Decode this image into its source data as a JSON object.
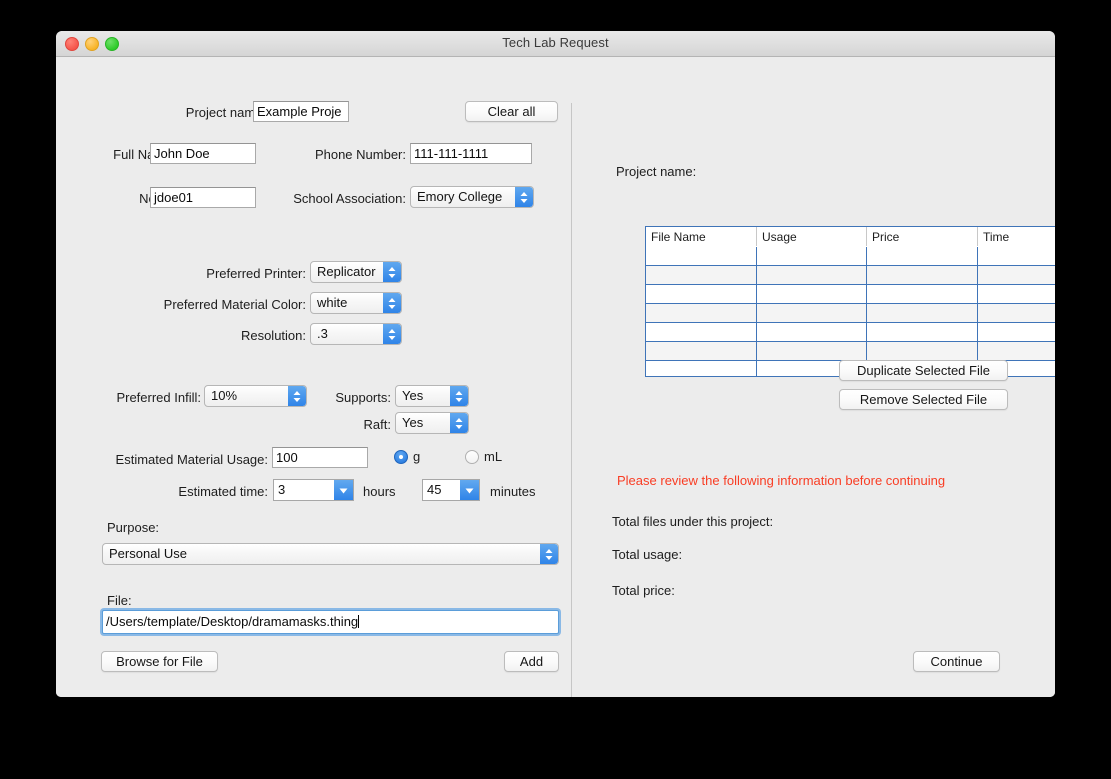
{
  "window": {
    "title": "Tech Lab Request",
    "traffic_lights": [
      "close",
      "minimize",
      "zoom"
    ]
  },
  "left_panel": {
    "project_name_label": "Project name:",
    "project_name_value": "Example Proje",
    "clear_all_label": "Clear all",
    "full_name_label": "Full Name:",
    "full_name_value": "John Doe",
    "phone_label": "Phone Number:",
    "phone_value": "111-111-1111",
    "netid_label": "NetID:",
    "netid_value": "jdoe01",
    "school_label": "School Association:",
    "school_value": "Emory College",
    "printer_label": "Preferred Printer:",
    "printer_value": "Replicator",
    "material_color_label": "Preferred Material Color:",
    "material_color_value": "white",
    "resolution_label": "Resolution:",
    "resolution_value": ".3",
    "infill_label": "Preferred Infill:",
    "infill_value": "10%",
    "supports_label": "Supports:",
    "supports_value": "Yes",
    "raft_label": "Raft:",
    "raft_value": "Yes",
    "material_usage_label": "Estimated Material Usage:",
    "material_usage_value": "100",
    "unit_g_label": "g",
    "unit_ml_label": "mL",
    "unit_selected": "g",
    "estimated_time_label": "Estimated time:",
    "hours_value": "3",
    "hours_unit_label": "hours",
    "minutes_value": "45",
    "minutes_unit_label": "minutes",
    "purpose_label": "Purpose:",
    "purpose_value": "Personal Use",
    "file_label": "File:",
    "file_value": "/Users/template/Desktop/dramamasks.thing",
    "browse_label": "Browse for File",
    "add_label": "Add"
  },
  "right_panel": {
    "project_name_label": "Project name:",
    "table": {
      "columns": [
        "File Name",
        "Usage",
        "Price",
        "Time"
      ],
      "rows": [
        [
          "",
          "",
          "",
          ""
        ],
        [
          "",
          "",
          "",
          ""
        ],
        [
          "",
          "",
          "",
          ""
        ],
        [
          "",
          "",
          "",
          ""
        ],
        [
          "",
          "",
          "",
          ""
        ],
        [
          "",
          "",
          "",
          ""
        ],
        [
          "",
          "",
          "",
          ""
        ]
      ]
    },
    "duplicate_label": "Duplicate Selected File",
    "remove_label": "Remove Selected File",
    "warning_text": "Please review the following information before continuing",
    "total_files_label": "Total files under this project:",
    "total_usage_label": "Total usage:",
    "total_price_label": "Total price:",
    "continue_label": "Continue"
  },
  "colors": {
    "window_bg": "#ececec",
    "accent_blue": "#2f84e8",
    "table_grid": "#3f74b8",
    "warning_red": "#f93d24",
    "focus_ring": "#6aa8e4"
  }
}
